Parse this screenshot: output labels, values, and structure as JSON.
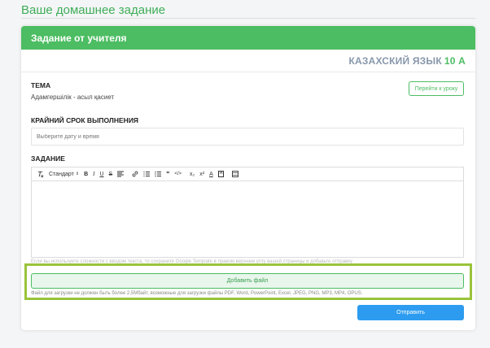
{
  "page": {
    "title": "Ваше домашнее задание"
  },
  "card": {
    "header": "Задание от учителя",
    "subject": "КАЗАХСКИЙ ЯЗЫК",
    "grade": "10 А"
  },
  "topic": {
    "label": "ТЕМА",
    "value": "Адамгершілік - асыл қасиет",
    "goto_button": "Перейти к уроку"
  },
  "deadline": {
    "label": "КРАЙНИЙ СРОК ВЫПОЛНЕНИЯ",
    "placeholder": "Выберите дату и время"
  },
  "assignment": {
    "label": "ЗАДАНИЕ",
    "toolbar": {
      "format_select": "Стандарт",
      "bold": "B",
      "italic": "I",
      "underline": "U",
      "strike": "S",
      "quote": "❞",
      "code": "</>",
      "subscript": "x₂",
      "superscript": "x²",
      "text_color": "A",
      "background_color": "A"
    }
  },
  "hint": "Если вы используете сложности с вводом текста, то сохраните Google Template в правом верхнем углу вашей страницы и добавьте отправку",
  "upload": {
    "button": "Добавить файл",
    "note": "Файл для загрузки не должен быть более 2,5Мбайт, возможные для загрузки файлы PDF, Word, PowerPoint, Excel, JPEG, PNG, MP3, MP4, OPUS."
  },
  "send_button": "Отправить",
  "colors": {
    "accent_green": "#4cbd62",
    "upload_highlight": "#9ac33b",
    "send_blue": "#2d9cf0",
    "subject_gray": "#8797ab"
  }
}
